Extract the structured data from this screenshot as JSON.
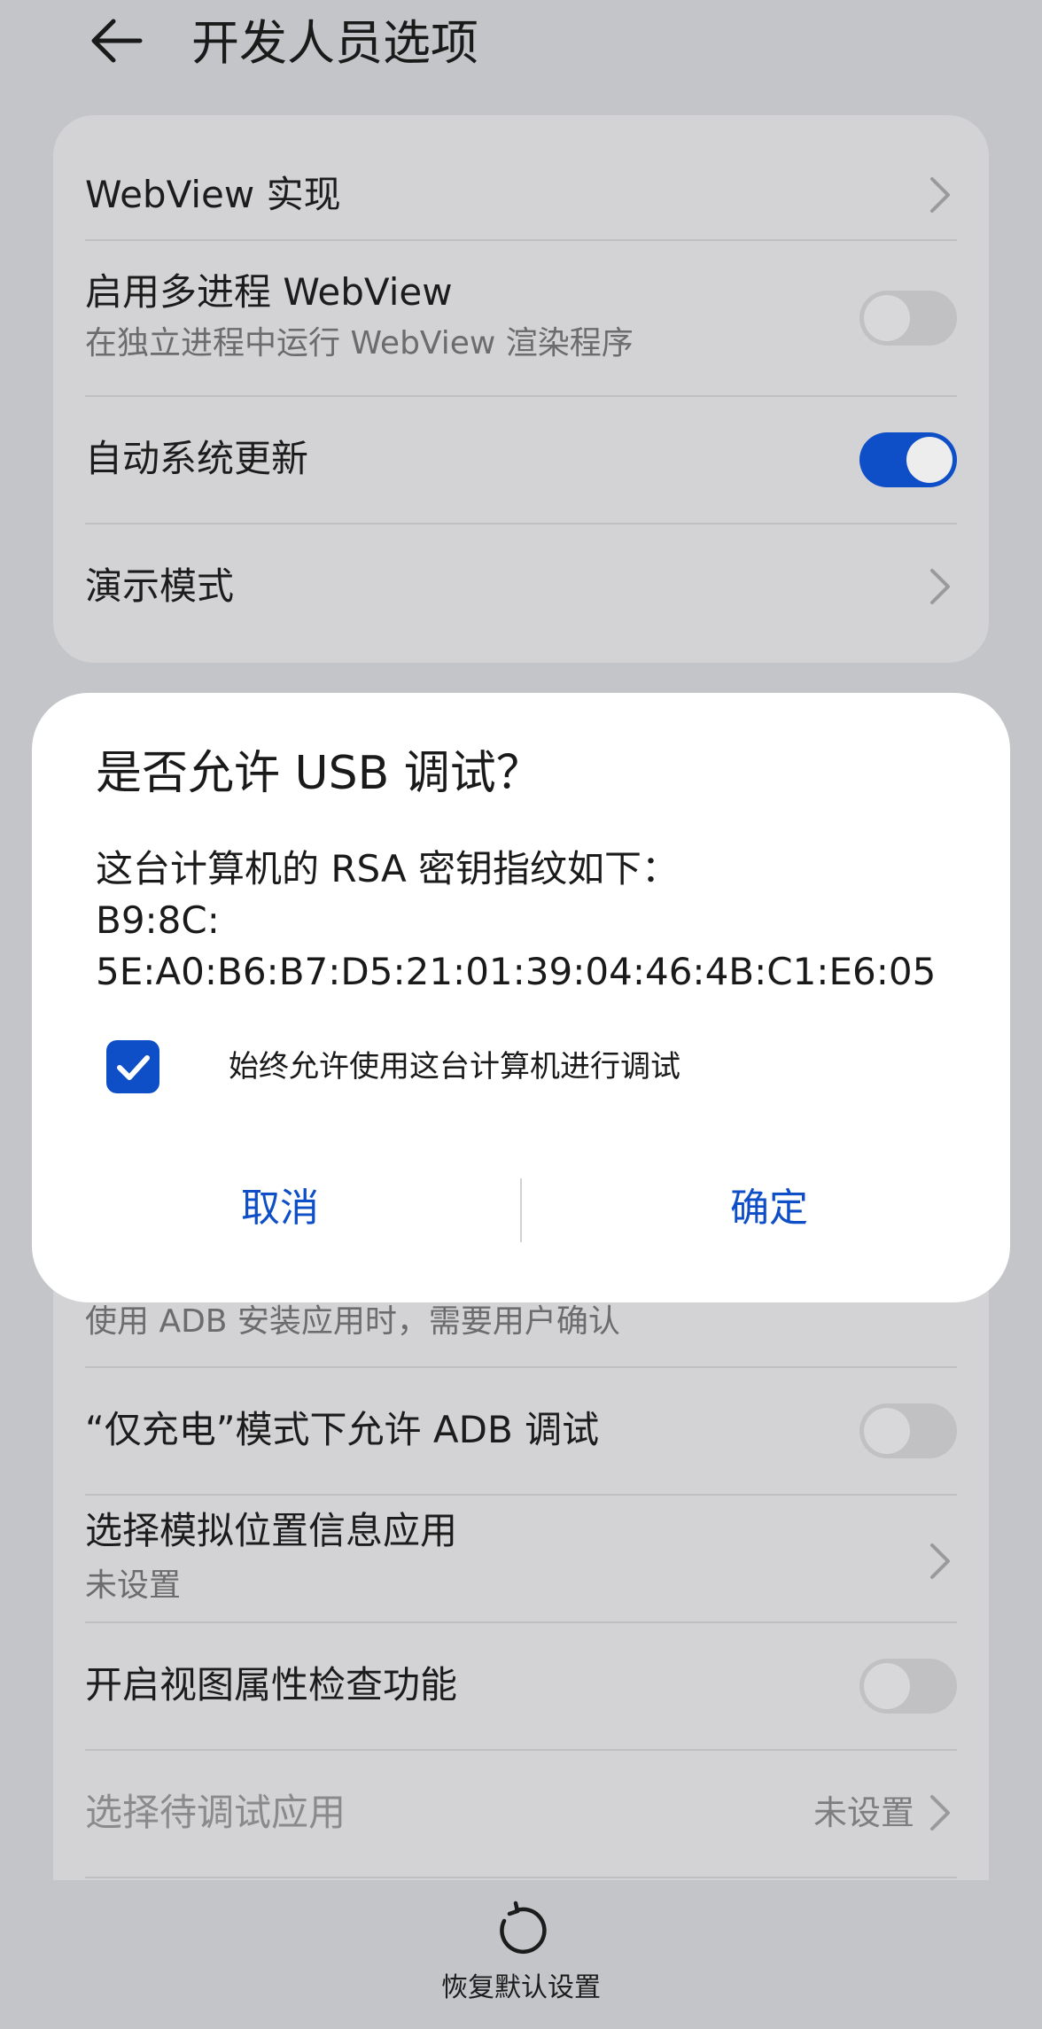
{
  "header": {
    "title": "开发人员选项",
    "back_icon": "arrow-left-icon"
  },
  "settings_top": [
    {
      "title": "WebView 实现",
      "control": "chevron"
    },
    {
      "title": "启用多进程 WebView",
      "subtitle": "在独立进程中运行 WebView 渲染程序",
      "control": "toggle",
      "state": "off"
    },
    {
      "title": "自动系统更新",
      "control": "toggle",
      "state": "on"
    },
    {
      "title": "演示模式",
      "control": "chevron"
    }
  ],
  "settings_bottom": [
    {
      "subtitle": "使用 ADB 安装应用时，需要用户确认",
      "control": "toggle",
      "state": "on"
    },
    {
      "title": "“仅充电”模式下允许 ADB 调试",
      "control": "toggle",
      "state": "off"
    },
    {
      "title": "选择模拟位置信息应用",
      "subtitle": "未设置",
      "control": "chevron"
    },
    {
      "title": "开启视图属性检查功能",
      "control": "toggle",
      "state": "off"
    },
    {
      "title": "选择待调试应用",
      "value": "未设置",
      "control": "chevron",
      "disabled": true
    }
  ],
  "dialog": {
    "title": "是否允许 USB 调试？",
    "body_lines": [
      "这台计算机的 RSA 密钥指纹如下：",
      "B9:8C:",
      "5E:A0:B6:B7:D5:21:01:39:04:46:4B:C1:E6:05"
    ],
    "checkbox_label": "始终允许使用这台计算机进行调试",
    "checkbox_checked": true,
    "cancel_label": "取消",
    "ok_label": "确定"
  },
  "footer": {
    "reset_label": "恢复默认设置",
    "reset_icon": "refresh-icon"
  },
  "colors": {
    "accent": "#0e4fc8",
    "background": "#c4c5c8",
    "card": "#d3d3d5",
    "dialog": "#ffffff"
  }
}
